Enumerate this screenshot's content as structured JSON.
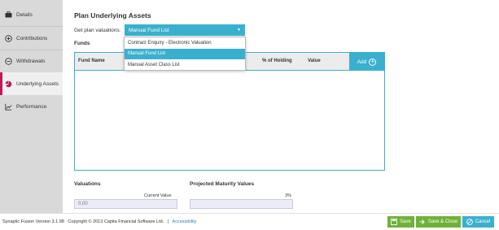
{
  "sidebar": {
    "items": [
      {
        "label": "Details",
        "icon": "briefcase-icon"
      },
      {
        "label": "Contributions",
        "icon": "plus-circle-icon"
      },
      {
        "label": "Withdrawals",
        "icon": "minus-circle-icon"
      },
      {
        "label": "Underlying Assets",
        "icon": "pie-chart-icon",
        "active": true
      },
      {
        "label": "Performance",
        "icon": "line-chart-icon"
      }
    ],
    "active_color": "#c2185b"
  },
  "main": {
    "title": "Plan Underlying Assets",
    "get_valuations_label": "Get plan valuations:",
    "dropdown": {
      "selected": "Manual Fund List",
      "options": [
        "Contract Enquiry - Electronic Valuation",
        "Manual Fund List",
        "Manual Asset Class List"
      ]
    },
    "funds_label": "Funds",
    "grid": {
      "columns": [
        "Fund Name",
        "% of Holding",
        "Value"
      ],
      "add_label": "Add",
      "rows": []
    },
    "valuations_label": "Valuations",
    "current_value_caption": "Current Value",
    "current_value": "0.00",
    "projected_label": "Projected Maturity Values",
    "percent_caption": "3%"
  },
  "footer": {
    "version": "Synaptic Fusion Version 3.1.98",
    "copyright": "Copyright © 2013 Capita Financial Software Ltd.",
    "separator": "|",
    "accessibility": "Accessibility",
    "save": "Save",
    "save_close": "Save & Close",
    "cancel": "Cancel"
  },
  "colors": {
    "accent": "#3ab0cf",
    "save_green": "#6fb23a",
    "sidebar_bg": "#d9d9d9"
  }
}
